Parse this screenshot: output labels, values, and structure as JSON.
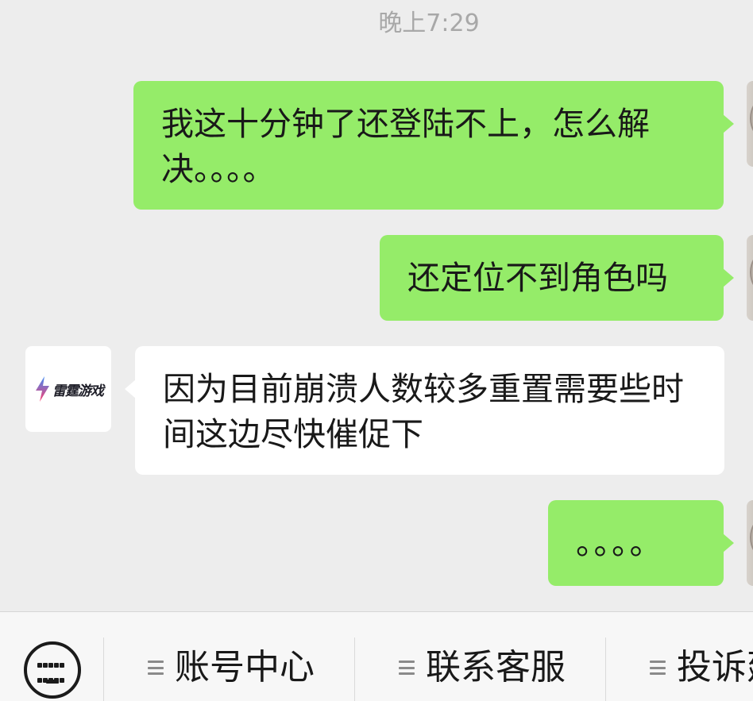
{
  "chat": {
    "timestamp": "晚上7:29",
    "messages": [
      {
        "sender": "me",
        "text": "我这十分钟了还登陆不上，怎么解决。。。。"
      },
      {
        "sender": "me",
        "text": "还定位不到角色吗"
      },
      {
        "sender": "service",
        "text": "因为目前崩溃人数较多重置需要些时间这边尽快催促下"
      },
      {
        "sender": "me",
        "text": "。。。。"
      }
    ]
  },
  "service_account": {
    "logo_text": "雷霆游戏",
    "icon": "lightning-bolt-icon",
    "colors": {
      "bolt_top": "#3f8cf5",
      "bolt_bottom": "#ff3d6e"
    }
  },
  "bottom_menu": {
    "keyboard_icon": "keyboard-icon",
    "items": [
      {
        "label": "账号中心",
        "icon": "menu-icon"
      },
      {
        "label": "联系客服",
        "icon": "menu-icon"
      },
      {
        "label": "投诉建议",
        "icon": "menu-icon"
      }
    ]
  },
  "colors": {
    "outgoing_bubble": "#95ec69",
    "incoming_bubble": "#ffffff",
    "chat_background": "#ededed"
  }
}
